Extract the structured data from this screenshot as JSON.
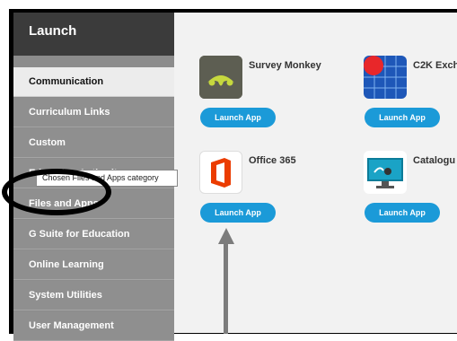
{
  "sidebar": {
    "title": "Launch",
    "items": [
      {
        "label": "Communication"
      },
      {
        "label": "Curriculum Links"
      },
      {
        "label": "Custom"
      },
      {
        "label": "Education Authority"
      },
      {
        "label": "Files and Apps"
      },
      {
        "label": "G Suite for Education"
      },
      {
        "label": "Online Learning"
      },
      {
        "label": "System Utilities"
      },
      {
        "label": "User Management"
      }
    ]
  },
  "apps": [
    {
      "name": "Survey Monkey",
      "button": "Launch App",
      "icon": "survey-monkey-icon"
    },
    {
      "name": "C2K Exch",
      "button": "Launch App",
      "icon": "c2k-exchange-icon"
    },
    {
      "name": "Office 365",
      "button": "Launch App",
      "icon": "office-365-icon"
    },
    {
      "name": "Catalogu",
      "button": "Launch App",
      "icon": "catalogue-icon"
    }
  ],
  "annotation": {
    "tooltip": "Chosen Files and Apps category"
  },
  "colors": {
    "sidebar_dark": "#3b3b3b",
    "sidebar_item": "#8f8f8f",
    "active_item": "#ececec",
    "button": "#1b9ad8"
  }
}
